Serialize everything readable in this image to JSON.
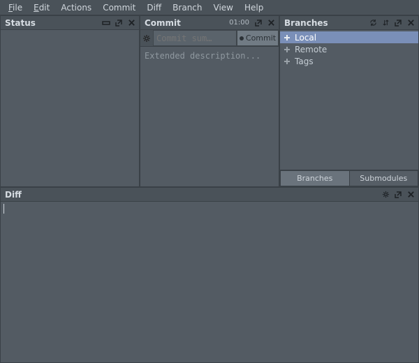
{
  "menubar": [
    {
      "label": "File",
      "underline": 0
    },
    {
      "label": "Edit",
      "underline": 0
    },
    {
      "label": "Actions"
    },
    {
      "label": "Commit"
    },
    {
      "label": "Diff"
    },
    {
      "label": "Branch"
    },
    {
      "label": "View"
    },
    {
      "label": "Help"
    }
  ],
  "status": {
    "title": "Status"
  },
  "commit": {
    "title": "Commit",
    "clock": "01:00",
    "summary_placeholder": "Commit sum…",
    "button_label": "Commit",
    "description_placeholder": "Extended description..."
  },
  "branches": {
    "title": "Branches",
    "items": [
      {
        "label": "Local",
        "selected": true
      },
      {
        "label": "Remote",
        "selected": false
      },
      {
        "label": "Tags",
        "selected": false
      }
    ],
    "tabs": {
      "branches": "Branches",
      "submodules": "Submodules"
    }
  },
  "diff": {
    "title": "Diff"
  }
}
